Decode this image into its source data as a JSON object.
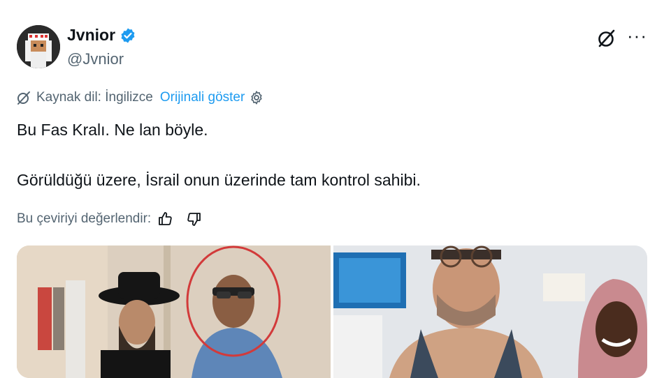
{
  "author": {
    "name": "Jvnior",
    "handle": "@Jvnior",
    "verified_color": "#1d9bf0"
  },
  "header_icons": [
    "grok-icon",
    "more-icon"
  ],
  "more_label": "···",
  "translation": {
    "source_label": "Kaynak dil: İngilizce",
    "show_original": "Orijinali göster",
    "rate_label": "Bu çeviriyi değerlendir:"
  },
  "tweet": {
    "line1": "Bu Fas Kralı. Ne lan böyle.",
    "line2": "Görüldüğü üzere, İsrail onun üzerinde tam kontrol sahibi."
  },
  "colors": {
    "accent": "#1d9bf0",
    "secondary_text": "#536471",
    "primary_text": "#0f1419"
  }
}
